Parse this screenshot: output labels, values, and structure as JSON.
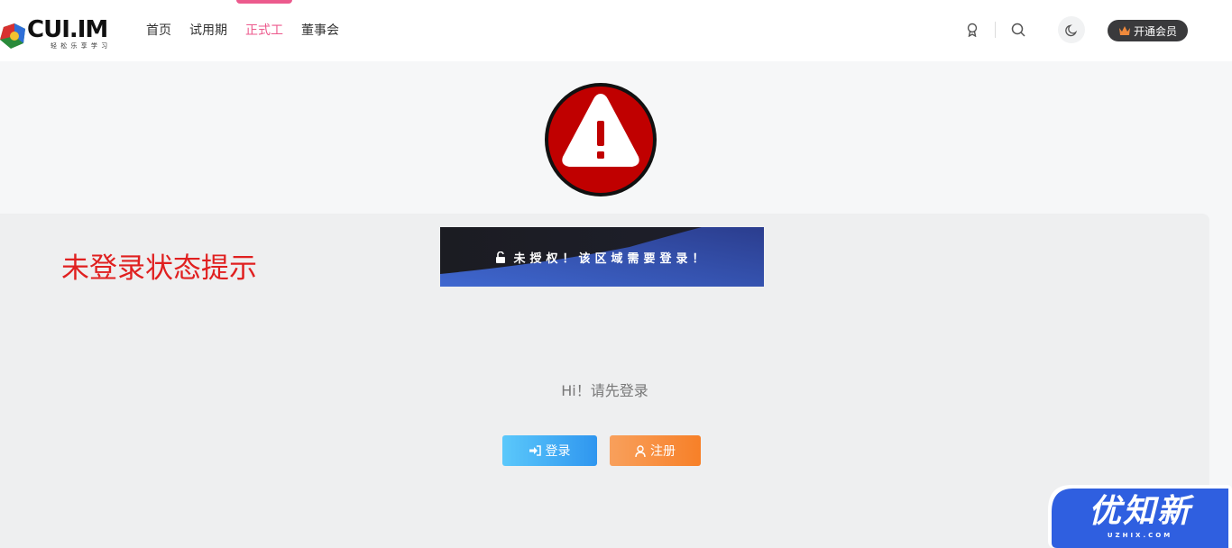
{
  "header": {
    "logo_text": "CUI.IM",
    "logo_tagline": "轻 松 乐 享 学 习",
    "nav": [
      {
        "label": "首页"
      },
      {
        "label": "试用期"
      },
      {
        "label": "正式工"
      },
      {
        "label": "董事会"
      }
    ],
    "active_nav_index": 2,
    "vip_label": "开通会员"
  },
  "annotation": "未登录状态提示",
  "banner": {
    "text": "未授权！该区域需要登录！",
    "icon": "lock-open-icon"
  },
  "prompt_text": "Hi！请先登录",
  "buttons": {
    "login": "登录",
    "register": "注册"
  },
  "watermark": {
    "text": "优知新",
    "sub": "UZHIX.COM"
  },
  "colors": {
    "accent": "#ec5a8d",
    "annotation": "#e02020",
    "login_button": "#2f96ef",
    "register_button": "#f78028",
    "warning_red": "#c00000"
  }
}
